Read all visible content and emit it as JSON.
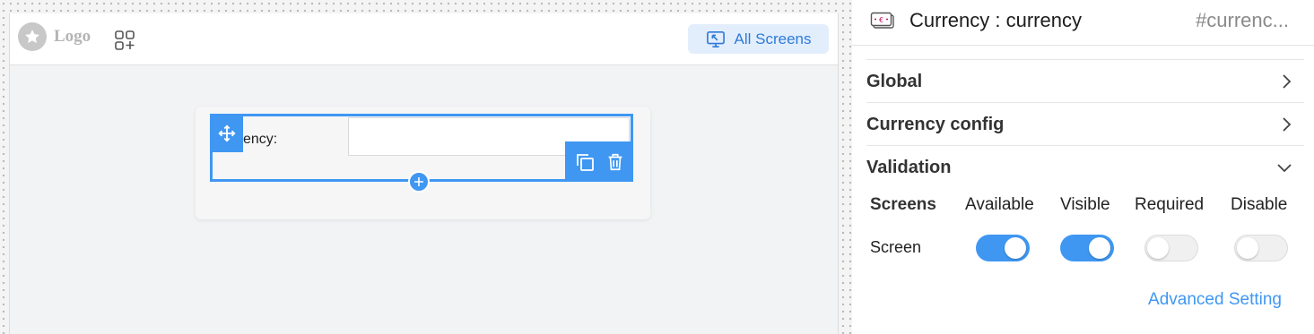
{
  "canvas": {
    "logo_text": "Logo",
    "all_screens_label": "All Screens",
    "field_label": "ency:",
    "field_value": ""
  },
  "panel": {
    "title": "Currency : currency",
    "id_text": "#currenc...",
    "sections": [
      {
        "label": "Global",
        "state": "collapsed"
      },
      {
        "label": "Currency config",
        "state": "collapsed"
      },
      {
        "label": "Validation",
        "state": "expanded"
      }
    ],
    "validation": {
      "columns": [
        "Screens",
        "Available",
        "Visible",
        "Required",
        "Disable"
      ],
      "rows": [
        {
          "name": "Screen",
          "available": true,
          "visible": true,
          "required": false,
          "disable": false
        }
      ]
    },
    "advanced_link": "Advanced Setting"
  },
  "colors": {
    "accent": "#3f97f2",
    "link": "#2e7ad8",
    "all_screens_bg": "#e2eefc"
  },
  "icons": [
    "star-icon",
    "add-widget-icon",
    "screens-icon",
    "move-icon",
    "copy-icon",
    "delete-icon",
    "plus-icon",
    "currency-icon",
    "chevron-right-icon",
    "chevron-down-icon"
  ]
}
